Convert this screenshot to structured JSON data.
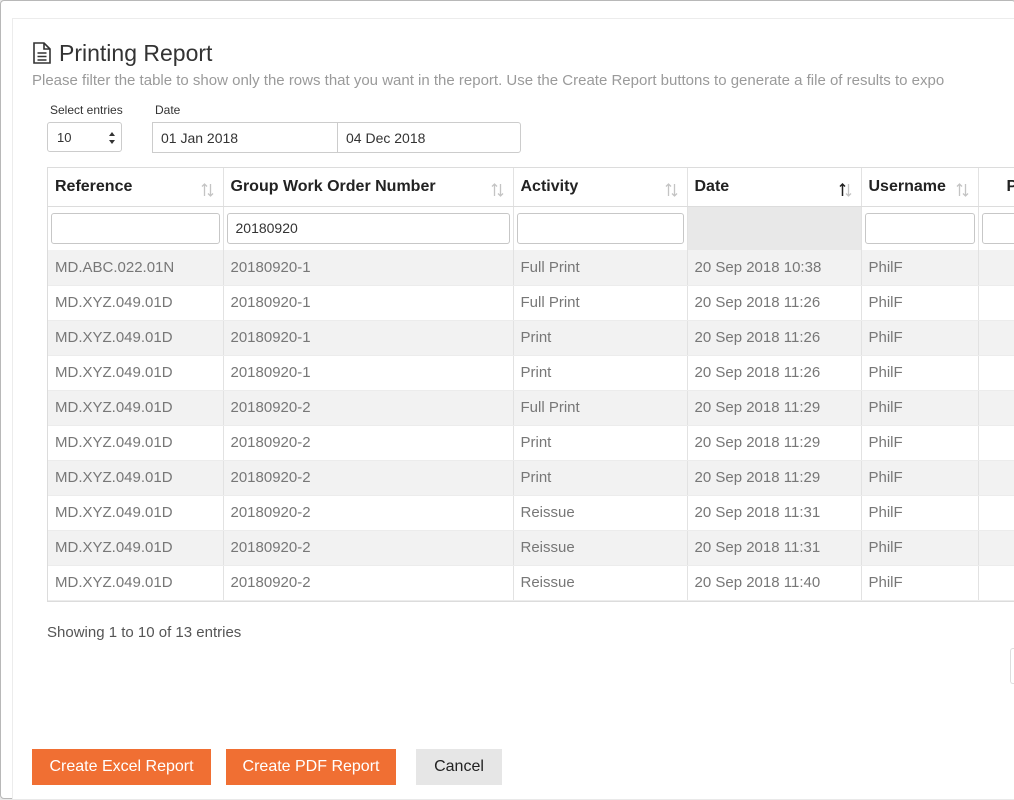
{
  "header": {
    "title": "Printing Report",
    "subtitle": "Please filter the table to show only the rows that you want in the report. Use the Create Report buttons to generate a file of results to expo"
  },
  "controls": {
    "select_entries_label": "Select entries",
    "select_entries_value": "10",
    "date_label": "Date",
    "date_from": "01 Jan 2018",
    "date_to": "04 Dec 2018"
  },
  "table": {
    "columns": [
      "Reference",
      "Group Work Order Number",
      "Activity",
      "Date",
      "Username",
      "P"
    ],
    "sorted_column": "Date",
    "filters": [
      "",
      "20180920",
      "",
      "",
      "",
      ""
    ],
    "rows": [
      [
        "MD.ABC.022.01N",
        "20180920-1",
        "Full Print",
        "20 Sep 2018 10:38",
        "PhilF",
        ""
      ],
      [
        "MD.XYZ.049.01D",
        "20180920-1",
        "Full Print",
        "20 Sep 2018 11:26",
        "PhilF",
        ""
      ],
      [
        "MD.XYZ.049.01D",
        "20180920-1",
        "Print",
        "20 Sep 2018 11:26",
        "PhilF",
        ""
      ],
      [
        "MD.XYZ.049.01D",
        "20180920-1",
        "Print",
        "20 Sep 2018 11:26",
        "PhilF",
        ""
      ],
      [
        "MD.XYZ.049.01D",
        "20180920-2",
        "Full Print",
        "20 Sep 2018 11:29",
        "PhilF",
        ""
      ],
      [
        "MD.XYZ.049.01D",
        "20180920-2",
        "Print",
        "20 Sep 2018 11:29",
        "PhilF",
        ""
      ],
      [
        "MD.XYZ.049.01D",
        "20180920-2",
        "Print",
        "20 Sep 2018 11:29",
        "PhilF",
        ""
      ],
      [
        "MD.XYZ.049.01D",
        "20180920-2",
        "Reissue",
        "20 Sep 2018 11:31",
        "PhilF",
        ""
      ],
      [
        "MD.XYZ.049.01D",
        "20180920-2",
        "Reissue",
        "20 Sep 2018 11:31",
        "PhilF",
        ""
      ],
      [
        "MD.XYZ.049.01D",
        "20180920-2",
        "Reissue",
        "20 Sep 2018 11:40",
        "PhilF",
        ""
      ]
    ]
  },
  "footer": {
    "info": "Showing 1 to 10 of 13 entries"
  },
  "buttons": {
    "excel": "Create Excel Report",
    "pdf": "Create PDF Report",
    "cancel": "Cancel"
  },
  "colors": {
    "accent": "#f06f33",
    "cancel_bg": "#e6e6e6",
    "stripe": "#f2f2f2"
  }
}
